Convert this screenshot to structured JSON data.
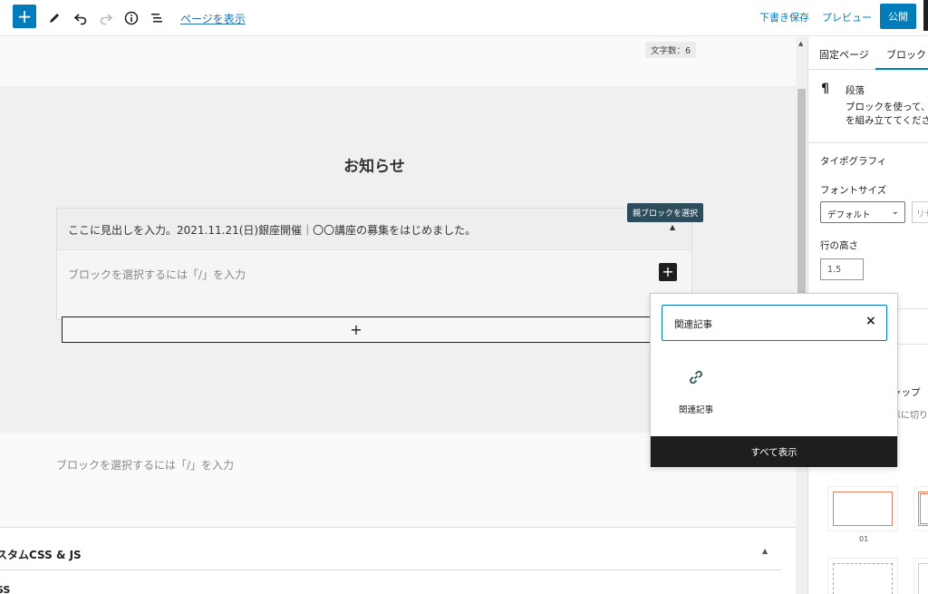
{
  "toolbar": {
    "add_label": "+",
    "view_page_link": "ページを表示",
    "save_draft": "下書き保存",
    "preview": "プレビュー",
    "publish": "公開"
  },
  "editor": {
    "word_count": "文字数：6",
    "heading": "お知らせ",
    "accordion_title": "ここに見出しを入力。2021.11.21(日)銀座開催｜〇〇講座の募集をはじめました。",
    "block_placeholder": "ブロックを選択するには「/」を入力",
    "inner_add": "+",
    "appender_plus": "+",
    "parent_tooltip": "親ブロックを選択",
    "paragraph_placeholder": "ブロックを選択するには「/」を入力",
    "custom_css_title": "スタムCSS & JS",
    "custom_css_sub": "SS"
  },
  "sidebar": {
    "tab_page": "固定ページ",
    "tab_block": "ブロック",
    "block_icon": "¶",
    "block_name": "段落",
    "block_desc_1": "ブロックを使って、",
    "block_desc_2": "を組み立ててくださ",
    "typography": "タイポグラフィ",
    "font_size_label": "フォントサイズ",
    "font_size_value": "デフォルト",
    "reset": "リセ",
    "line_height_label": "行の高さ",
    "line_height_value": "1.5",
    "capture_fragment": "ャップ",
    "capture_fragment2": "示に切り",
    "thumb_label": "01"
  },
  "inserter": {
    "search_value": "関連記事",
    "clear_icon": "×",
    "result_label": "関連記事",
    "show_all": "すべて表示"
  },
  "colors": {
    "accent": "#007cba",
    "tooltip": "#2e4d5c",
    "dark": "#1e1e1e"
  }
}
